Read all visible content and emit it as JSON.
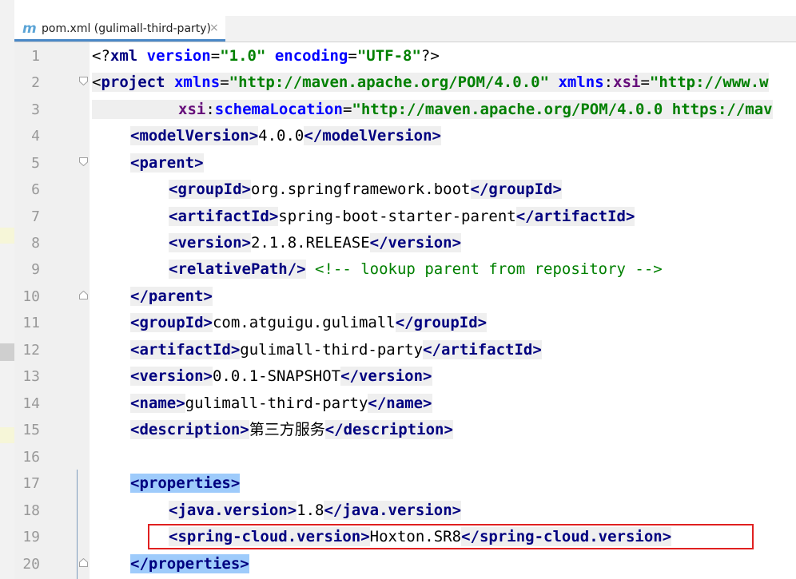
{
  "tab": {
    "icon": "maven-m-icon",
    "glyph": "m",
    "title": "pom.xml (gulimall-third-party)",
    "close": "×"
  },
  "colors": {
    "tag": "#000080",
    "string": "#008000",
    "attr": "#0000ff",
    "namespace": "#660e7a",
    "comment": "#008000",
    "highlight": "#9ecbfb",
    "redbox": "#e02020"
  },
  "lines": [
    {
      "n": "1"
    },
    {
      "n": "2"
    },
    {
      "n": "3"
    },
    {
      "n": "4"
    },
    {
      "n": "5"
    },
    {
      "n": "6"
    },
    {
      "n": "7"
    },
    {
      "n": "8"
    },
    {
      "n": "9"
    },
    {
      "n": "10"
    },
    {
      "n": "11"
    },
    {
      "n": "12"
    },
    {
      "n": "13"
    },
    {
      "n": "14"
    },
    {
      "n": "15"
    },
    {
      "n": "16"
    },
    {
      "n": "17"
    },
    {
      "n": "18"
    },
    {
      "n": "19"
    },
    {
      "n": "20"
    }
  ],
  "code": {
    "l1": {
      "a": "<?",
      "b": "xml",
      "c": " ",
      "d": "version",
      "e": "=",
      "f": "\"1.0\"",
      "g": " ",
      "h": "encoding",
      "i": "=",
      "j": "\"UTF-8\"",
      "k": "?>"
    },
    "l2": {
      "a": "<",
      "b": "project",
      "c": " ",
      "d": "xmlns",
      "e": "=",
      "f": "\"http://maven.apache.org/POM/4.0.0\"",
      "g": " ",
      "h": "xmlns",
      "i": ":",
      "j": "xsi",
      "k": "=",
      "l": "\"http://www.w"
    },
    "l3": {
      "a": "xsi",
      "b": ":",
      "c": "schemaLocation",
      "d": "=",
      "e": "\"http://maven.apache.org/POM/4.0.0 https://mav"
    },
    "l4": {
      "open": "<modelVersion>",
      "text": "4.0.0",
      "close": "</modelVersion>"
    },
    "l5": {
      "open": "<parent>"
    },
    "l6": {
      "open": "<groupId>",
      "text": "org.springframework.boot",
      "close": "</groupId>"
    },
    "l7": {
      "open": "<artifactId>",
      "text": "spring-boot-starter-parent",
      "close": "</artifactId>"
    },
    "l8": {
      "open": "<version>",
      "text": "2.1.8.RELEASE",
      "close": "</version>"
    },
    "l9": {
      "open": "<relativePath/>",
      "space": " ",
      "comment": "<!-- lookup parent from repository -->"
    },
    "l10": {
      "close": "</parent>"
    },
    "l11": {
      "open": "<groupId>",
      "text": "com.atguigu.gulimall",
      "close": "</groupId>"
    },
    "l12": {
      "open": "<artifactId>",
      "text": "gulimall-third-party",
      "close": "</artifactId>"
    },
    "l13": {
      "open": "<version>",
      "text": "0.0.1-SNAPSHOT",
      "close": "</version>"
    },
    "l14": {
      "open": "<name>",
      "text": "gulimall-third-party",
      "close": "</name>"
    },
    "l15": {
      "open": "<description>",
      "text": "第三方服务",
      "close": "</description>"
    },
    "l17": {
      "open": "<properties>"
    },
    "l18": {
      "open": "<java.version>",
      "text": "1.8",
      "close": "</java.version>"
    },
    "l19": {
      "open": "<spring-cloud.version>",
      "text": "Hoxton.SR8",
      "close": "</spring-cloud.version>"
    },
    "l20": {
      "close": "</properties>"
    }
  }
}
